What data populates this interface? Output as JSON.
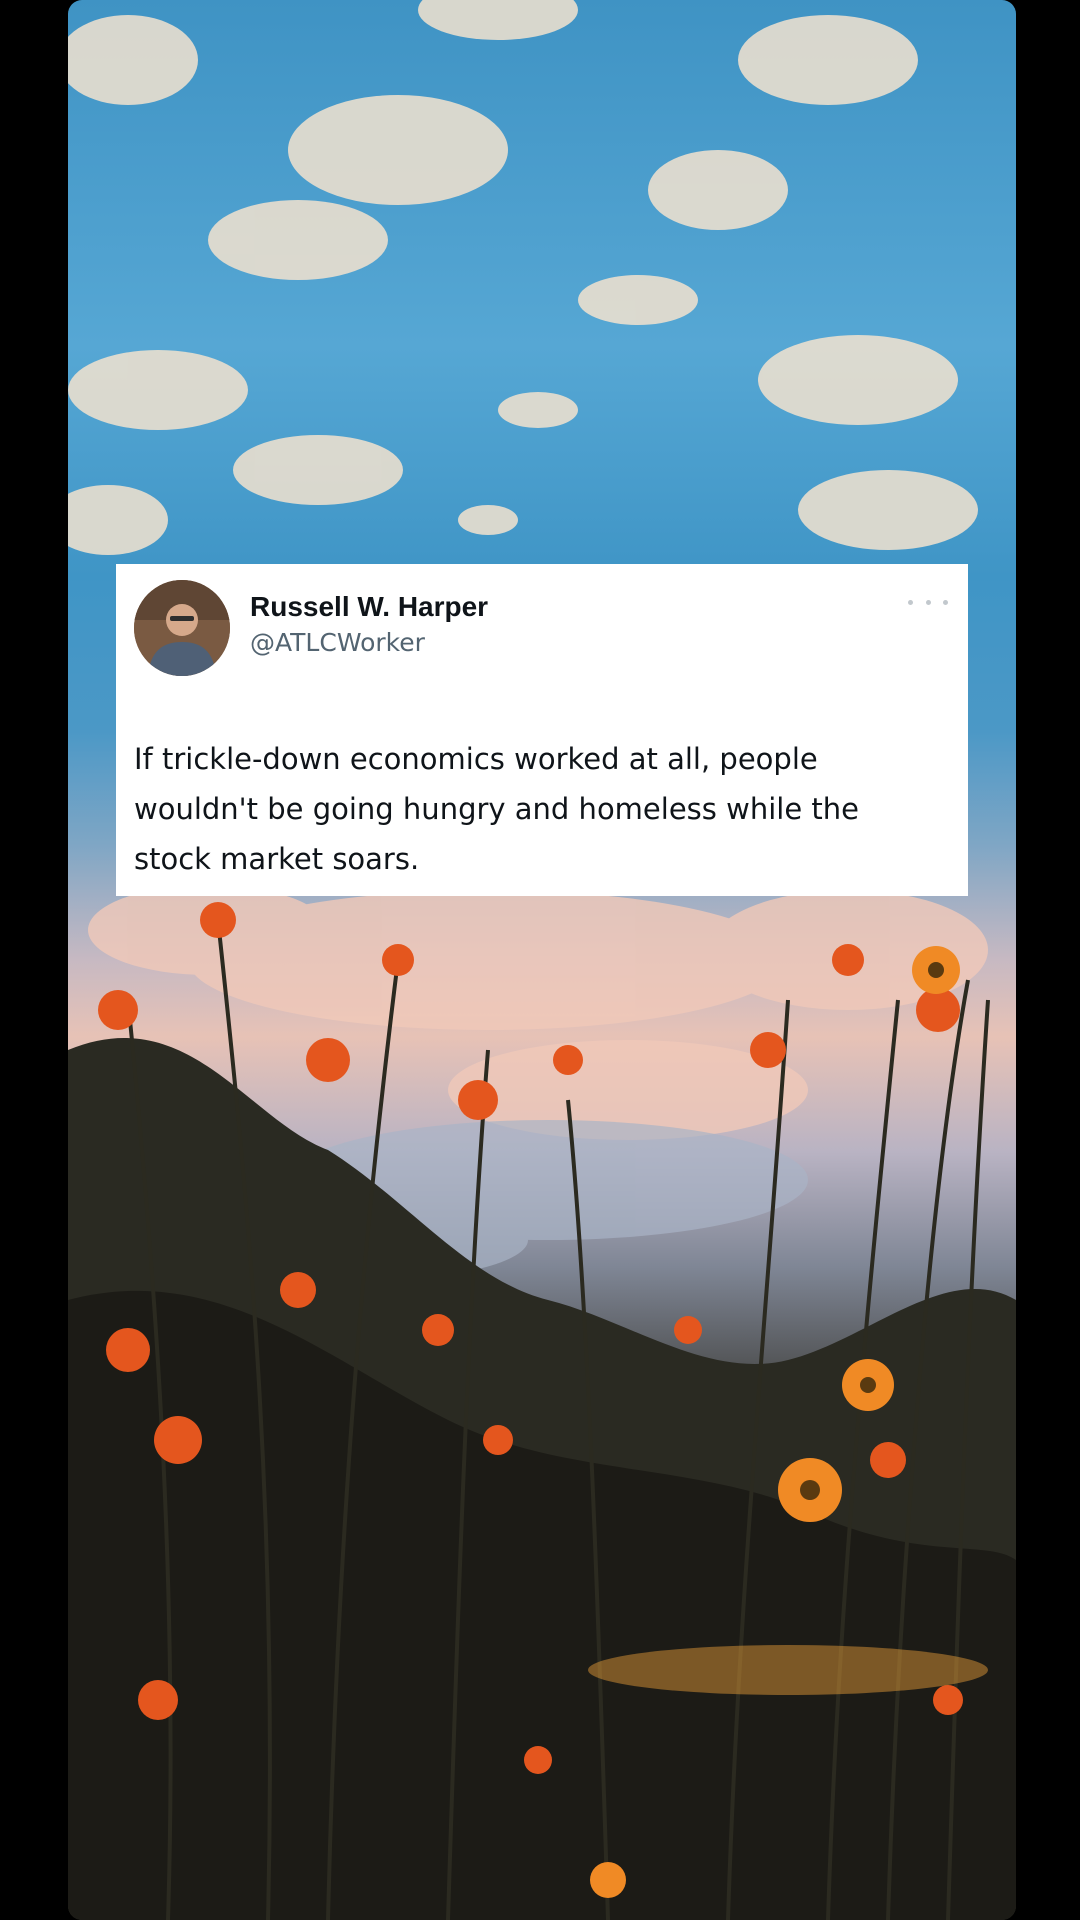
{
  "tweet": {
    "display_name": "Russell W. Harper",
    "handle": "@ATLCWorker",
    "text": "If trickle-down economics worked at all, people wouldn't be going hungry and homeless while the stock market soars.",
    "more_icon": "more-horizontal-icon"
  },
  "background": {
    "description_icon": "sky-and-flowers-photo"
  },
  "colors": {
    "card_bg": "#ffffff",
    "text": "#0f1419",
    "secondary_text": "#536471",
    "frame_bg": "#000000"
  }
}
